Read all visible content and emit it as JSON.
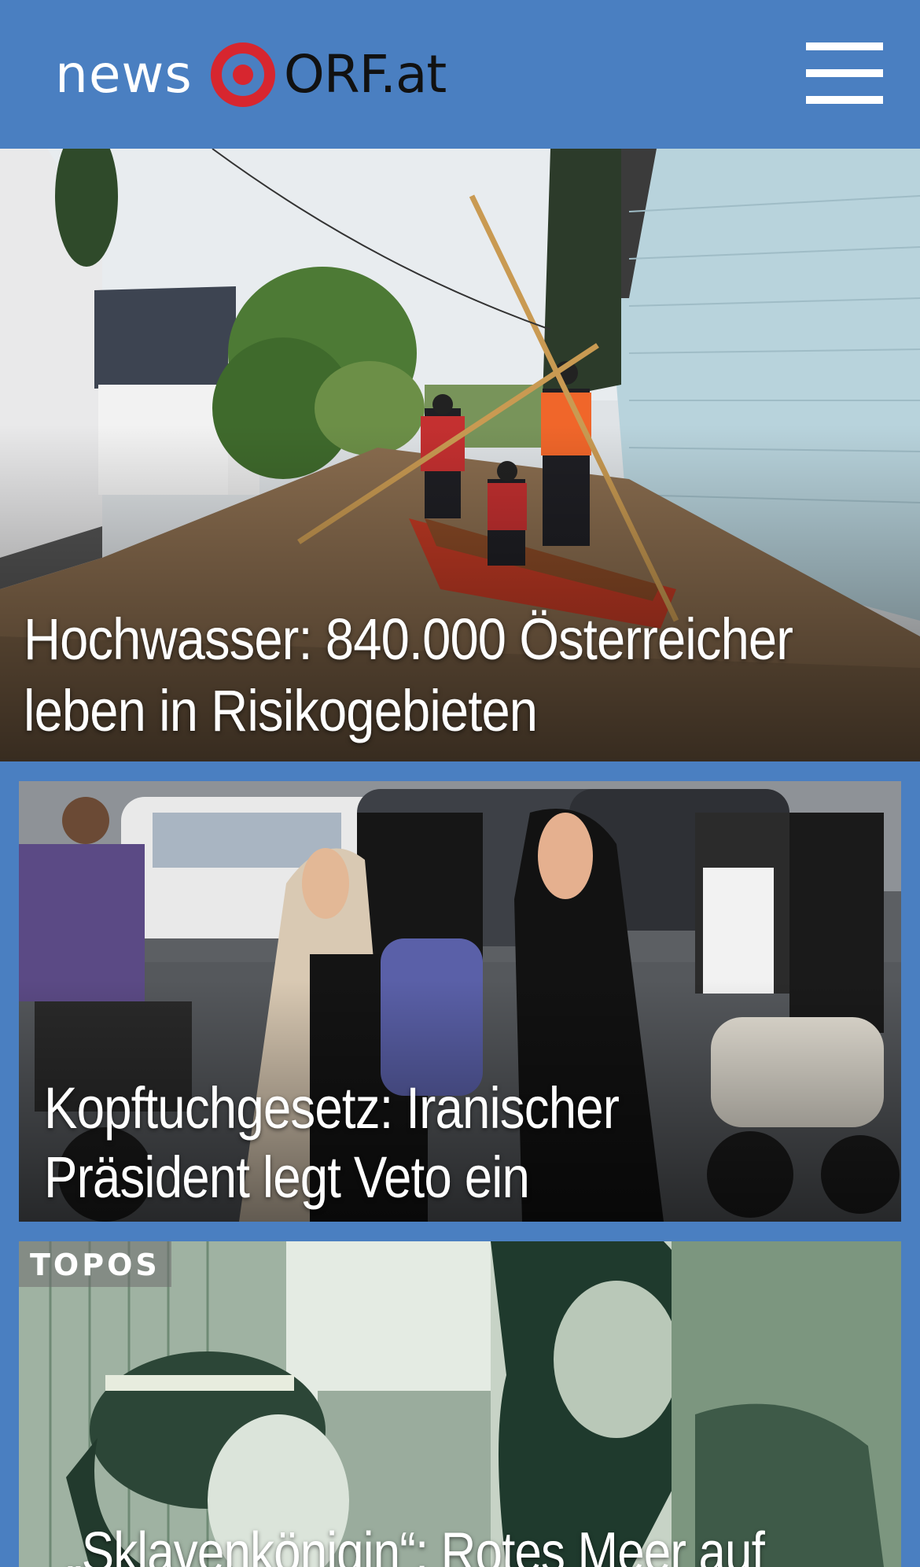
{
  "header": {
    "logo_news": "news",
    "logo_orf": "ORF.at",
    "menu_icon": "hamburger-menu-icon",
    "background_color": "#4a7fc1",
    "logo_ring_color": "#d7262f"
  },
  "stories": [
    {
      "headline": "Hochwasser: 840.000 Österreicher leben in Risikogebieten",
      "image": "flood-rescue-boat-photo"
    },
    {
      "headline": "Kopftuchgesetz: Iranischer Präsident legt Veto ein",
      "image": "tehran-street-women-photo"
    },
    {
      "topic": "TOPOS",
      "headline": "„Sklavenkönigin“: Rotes Meer auf",
      "image": "vintage-film-still-photo"
    }
  ]
}
